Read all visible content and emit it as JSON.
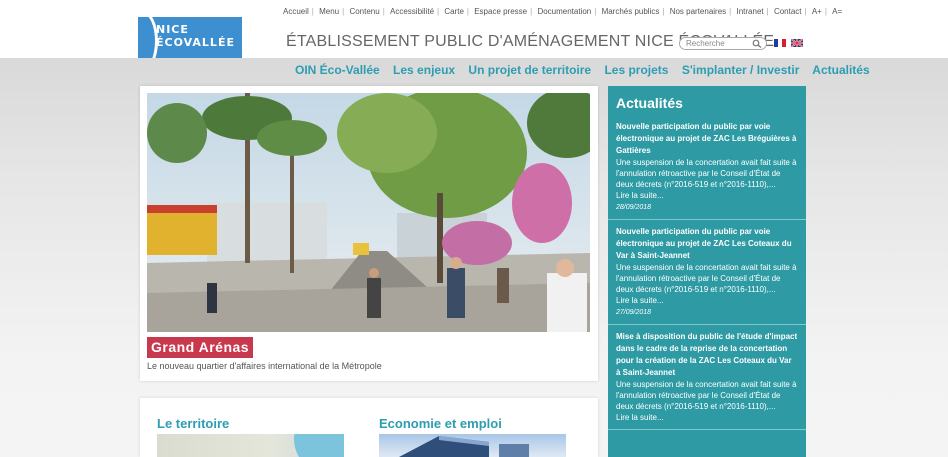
{
  "brand": {
    "line1": "NICE",
    "line2": "ÉCOVALLÉE"
  },
  "utility_nav": [
    "Accueil",
    "Menu",
    "Contenu",
    "Accessibilité",
    "Carte",
    "Espace presse",
    "Documentation",
    "Marchés publics",
    "Nos partenaires",
    "Intranet",
    "Contact",
    "A+",
    "A="
  ],
  "site_title": "ÉTABLISSEMENT PUBLIC D'AMÉNAGEMENT NICE ÉCOVALLÉE",
  "search": {
    "placeholder": "Recherche"
  },
  "languages": [
    "fr-flag-icon",
    "uk-flag-icon"
  ],
  "main_nav": [
    "OIN Éco-Vallée",
    "Les enjeux",
    "Un projet de territoire",
    "Les projets",
    "S'implanter / Investir",
    "Actualités"
  ],
  "hero": {
    "label": "Grand Arénas",
    "caption": "Le nouveau quartier d'affaires international de la Métropole"
  },
  "news": {
    "heading": "Actualités",
    "items": [
      {
        "title": "Nouvelle participation du public par voie électronique au projet de ZAC Les Bréguières à Gattières",
        "body": "Une suspension de la concertation avait fait suite à l'annulation rétroactive par le Conseil d'État de deux décrets (n°2016-519 et n°2016-1110),...",
        "more": "Lire la suite...",
        "date": "28/09/2018"
      },
      {
        "title": "Nouvelle participation du public par voie électronique au projet de ZAC Les Coteaux du Var à Saint-Jeannet",
        "body": "Une suspension de la concertation avait fait suite à l'annulation rétroactive par le Conseil d'État de deux décrets (n°2016-519 et n°2016-1110),...",
        "more": "Lire la suite...",
        "date": "27/09/2018"
      },
      {
        "title": "Mise à disposition du public de l'étude d'impact dans le cadre de la reprise de la concertation pour la création de la ZAC Les Coteaux du Var à Saint-Jeannet",
        "body": "Une suspension de la concertation avait fait suite à l'annulation rétroactive par le Conseil d'État de deux décrets (n°2016-519 et n°2016-1110),...",
        "more": "Lire la suite...",
        "date": ""
      }
    ]
  },
  "sections": {
    "territoire": "Le territoire",
    "economie": "Economie et emploi"
  },
  "colors": {
    "accent": "#2d9db0",
    "news_bg": "#2d9aa4",
    "hero_label": "#c9394d",
    "logo_bg": "#3d8fd0"
  }
}
